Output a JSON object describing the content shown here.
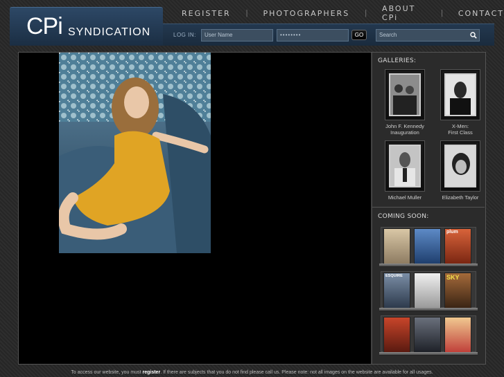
{
  "brand": {
    "logo_main": "CPi",
    "logo_sub": "SYNDICATION"
  },
  "nav": {
    "items": [
      "REGISTER",
      "PHOTOGRAPHERS",
      "ABOUT CPi",
      "CONTACT"
    ]
  },
  "login": {
    "label": "LOG IN:",
    "username_placeholder": "User Name",
    "password_value": "••••••••",
    "go_label": "GO",
    "search_placeholder": "Search"
  },
  "sidebar": {
    "galleries_title": "GALLERIES:",
    "galleries": [
      {
        "caption_line1": "John F. Kennedy",
        "caption_line2": "Inauguration"
      },
      {
        "caption_line1": "X-Men:",
        "caption_line2": "First Class"
      },
      {
        "caption_line1": "Michael Muller",
        "caption_line2": ""
      },
      {
        "caption_line1": "Elizabeth Taylor",
        "caption_line2": ""
      }
    ],
    "coming_soon_title": "COMING SOON:",
    "magazines": [
      {
        "masthead": "",
        "color": "#c9b89a"
      },
      {
        "masthead": "",
        "color": "#3d6fb0"
      },
      {
        "masthead": "plum",
        "color": "#b4482a"
      },
      {
        "masthead": "ESQUIRE",
        "color": "#6a7d96"
      },
      {
        "masthead": "",
        "color": "#d8d8d8"
      },
      {
        "masthead": "SKY",
        "color": "#7a4a2a"
      },
      {
        "masthead": "",
        "color": "#a83a2a"
      },
      {
        "masthead": "",
        "color": "#4a4f5a"
      },
      {
        "masthead": "",
        "color": "#e0b070"
      }
    ]
  },
  "footer": {
    "before": "To access our website, you must ",
    "link": "register",
    "after": ". If there are subjects that you do not find please call us. Please note: not all images on the website are available for all usages."
  },
  "colors": {
    "header": "#1f3349",
    "accent": "#2d4866",
    "viewer_bg": "#000000",
    "dress": "#e0a424"
  }
}
